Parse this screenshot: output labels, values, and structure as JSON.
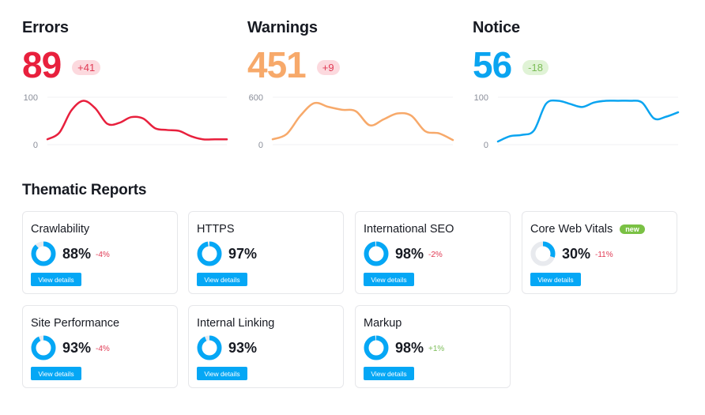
{
  "metrics": [
    {
      "id": "errors",
      "title": "Errors",
      "value": "89",
      "delta": "+41",
      "color": "#e8203d",
      "delta_bg": "#fcd9de",
      "delta_color": "#e03a54",
      "y_ticks": [
        "100",
        "0"
      ]
    },
    {
      "id": "warnings",
      "title": "Warnings",
      "value": "451",
      "delta": "+9",
      "color": "#f7a96a",
      "delta_bg": "#fcd9de",
      "delta_color": "#e03a54",
      "y_ticks": [
        "600",
        "0"
      ]
    },
    {
      "id": "notice",
      "title": "Notice",
      "value": "56",
      "delta": "-18",
      "color": "#0aa4f0",
      "delta_bg": "#e0f3d6",
      "delta_color": "#7cbd58",
      "y_ticks": [
        "100",
        "0"
      ]
    }
  ],
  "chart_data": [
    {
      "type": "line",
      "title": "Errors",
      "ylim": [
        0,
        100
      ],
      "y_ticks": [
        0,
        100
      ],
      "grid": true,
      "values": [
        5,
        20,
        70,
        92,
        75,
        40,
        42,
        55,
        52,
        30,
        26,
        24,
        12,
        5,
        5,
        5
      ]
    },
    {
      "type": "line",
      "title": "Warnings",
      "ylim": [
        0,
        600
      ],
      "y_ticks": [
        0,
        600
      ],
      "grid": true,
      "values": [
        30,
        100,
        350,
        520,
        470,
        430,
        410,
        220,
        300,
        380,
        350,
        140,
        110,
        20
      ]
    },
    {
      "type": "line",
      "title": "Notice",
      "ylim": [
        0,
        100
      ],
      "y_ticks": [
        0,
        100
      ],
      "grid": true,
      "values": [
        0,
        12,
        15,
        25,
        85,
        92,
        85,
        78,
        88,
        92,
        92,
        92,
        88,
        52,
        56,
        66
      ]
    }
  ],
  "thematic": {
    "title": "Thematic Reports",
    "button_label": "View details",
    "cards": [
      {
        "name": "Crawlability",
        "percent": 88,
        "label": "88%",
        "delta": "-4%",
        "delta_type": "neg",
        "badge": ""
      },
      {
        "name": "HTTPS",
        "percent": 97,
        "label": "97%",
        "delta": "",
        "delta_type": "",
        "badge": ""
      },
      {
        "name": "International SEO",
        "percent": 98,
        "label": "98%",
        "delta": "-2%",
        "delta_type": "neg",
        "badge": ""
      },
      {
        "name": "Core Web Vitals",
        "percent": 30,
        "label": "30%",
        "delta": "-11%",
        "delta_type": "neg",
        "badge": "new"
      },
      {
        "name": "Site Performance",
        "percent": 93,
        "label": "93%",
        "delta": "-4%",
        "delta_type": "neg",
        "badge": ""
      },
      {
        "name": "Internal Linking",
        "percent": 93,
        "label": "93%",
        "delta": "",
        "delta_type": "",
        "badge": ""
      },
      {
        "name": "Markup",
        "percent": 98,
        "label": "98%",
        "delta": "+1%",
        "delta_type": "pos",
        "badge": ""
      }
    ]
  },
  "colors": {
    "accent": "#05a7f5",
    "negative": "#e03a54",
    "positive": "#7cbd58",
    "donut_track": "#e8eaee"
  }
}
